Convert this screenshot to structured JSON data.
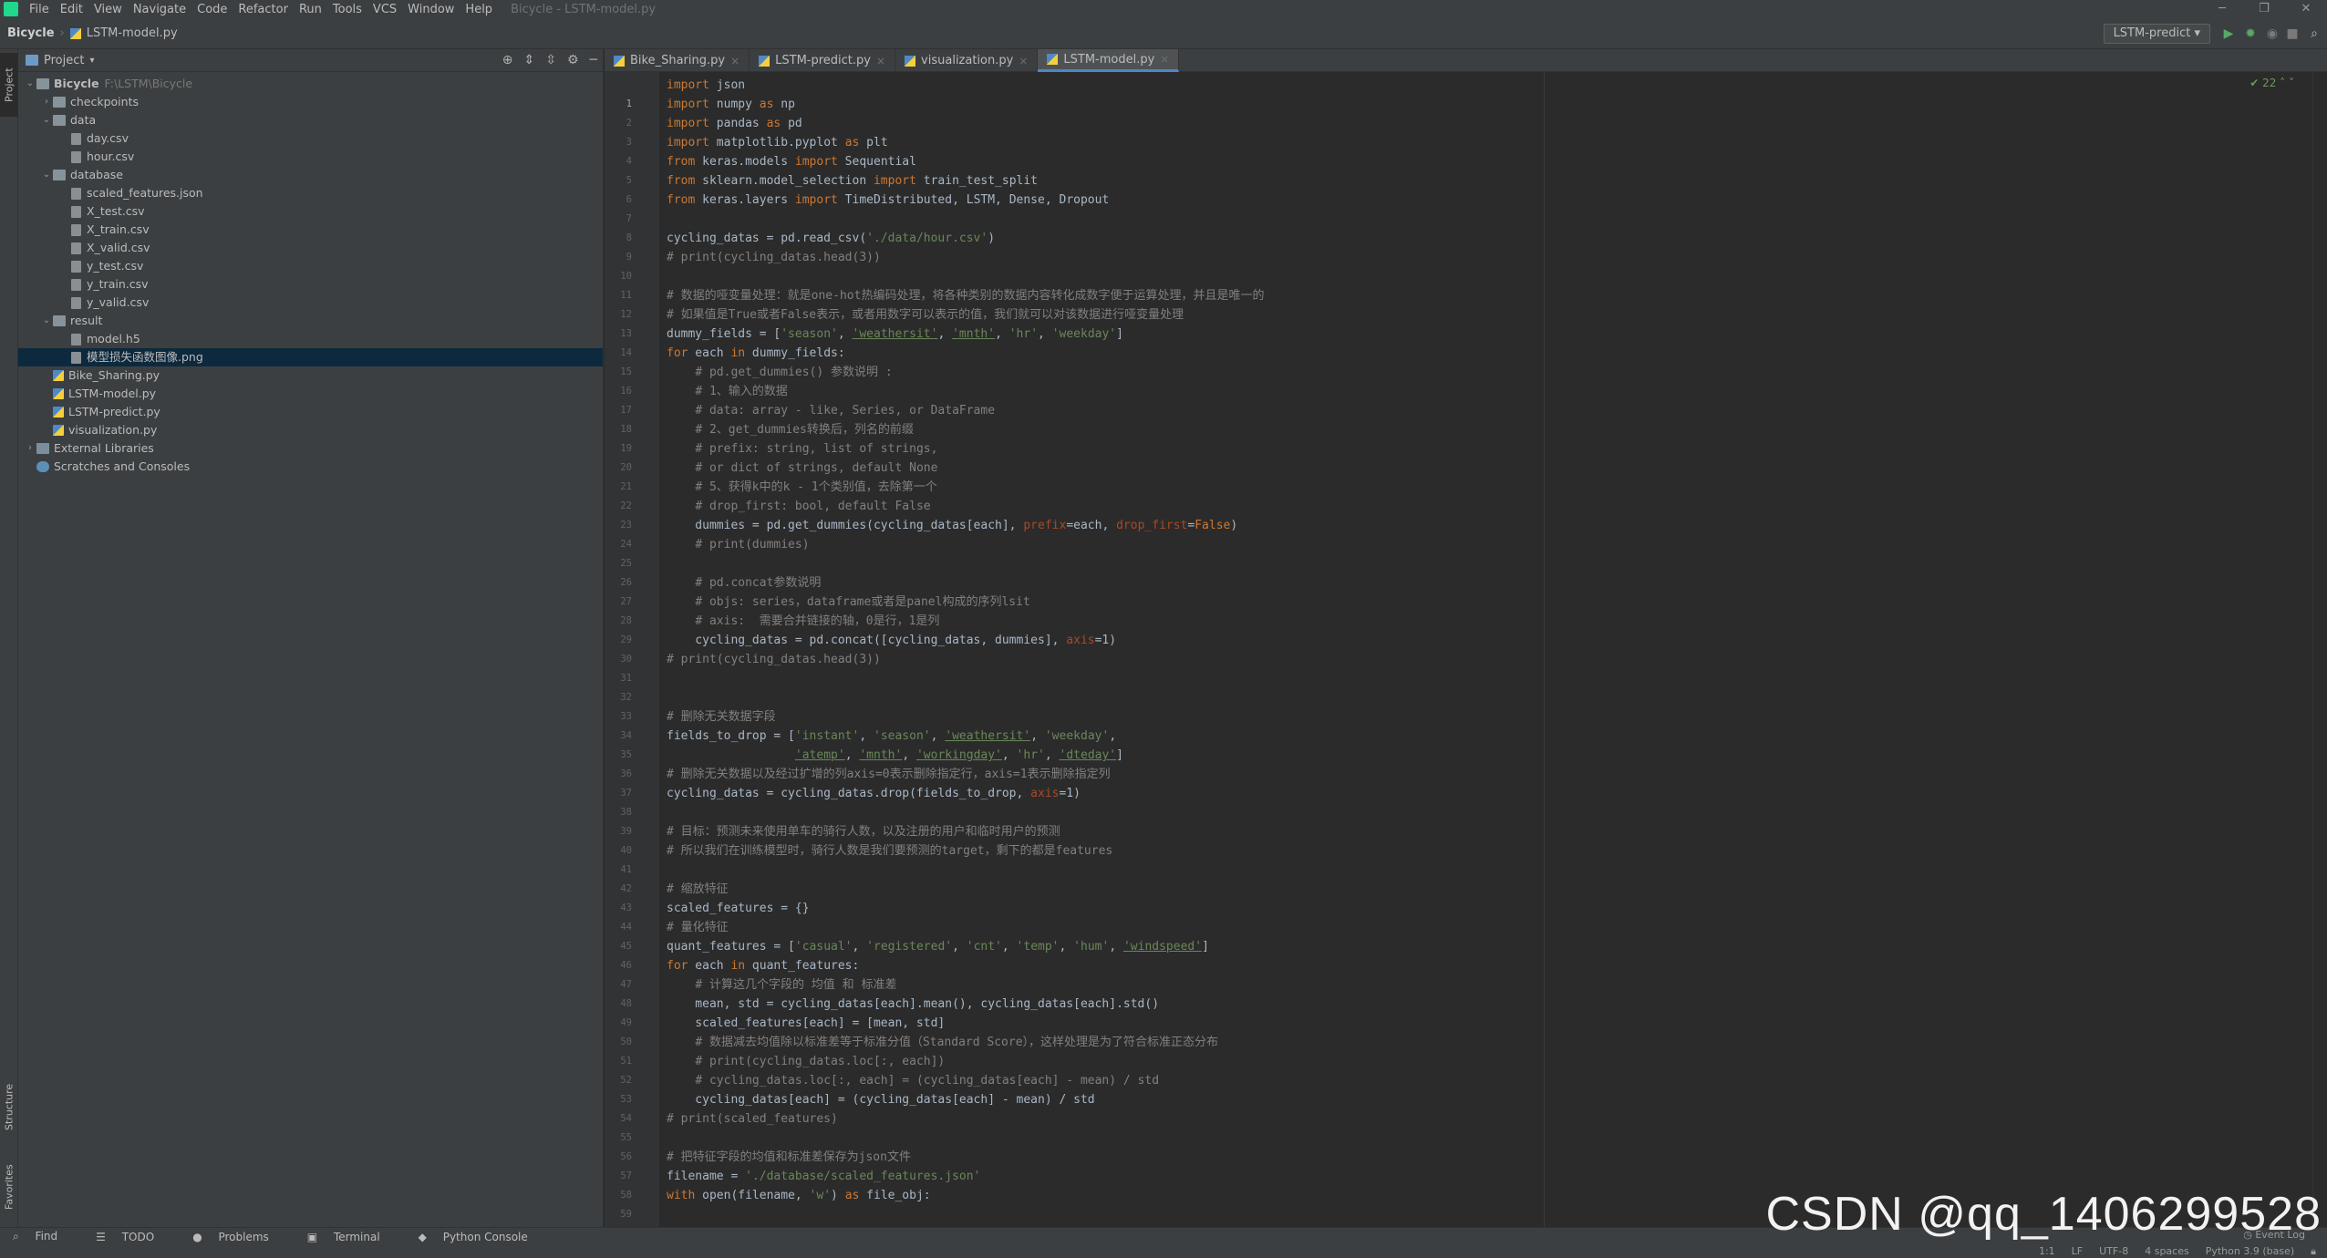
{
  "menubar": {
    "items": [
      "File",
      "Edit",
      "View",
      "Navigate",
      "Code",
      "Refactor",
      "Run",
      "Tools",
      "VCS",
      "Window",
      "Help"
    ],
    "window_title": "Bicycle - LSTM-model.py"
  },
  "navbar": {
    "project": "Bicycle",
    "file": "LSTM-model.py",
    "run_config": "LSTM-predict"
  },
  "sidebar": {
    "tabs": [
      "Project",
      "Structure",
      "Favorites"
    ],
    "header": "Project",
    "tree": [
      {
        "label": "Bicycle",
        "extra": "F:\\LSTM\\Bicycle",
        "depth": 0,
        "type": "folder",
        "open": true,
        "bold": true
      },
      {
        "label": "checkpoints",
        "depth": 1,
        "type": "folder",
        "open": false
      },
      {
        "label": "data",
        "depth": 1,
        "type": "folder",
        "open": true
      },
      {
        "label": "day.csv",
        "depth": 2,
        "type": "file"
      },
      {
        "label": "hour.csv",
        "depth": 2,
        "type": "file"
      },
      {
        "label": "database",
        "depth": 1,
        "type": "folder",
        "open": true
      },
      {
        "label": "scaled_features.json",
        "depth": 2,
        "type": "file"
      },
      {
        "label": "X_test.csv",
        "depth": 2,
        "type": "file"
      },
      {
        "label": "X_train.csv",
        "depth": 2,
        "type": "file"
      },
      {
        "label": "X_valid.csv",
        "depth": 2,
        "type": "file"
      },
      {
        "label": "y_test.csv",
        "depth": 2,
        "type": "file"
      },
      {
        "label": "y_train.csv",
        "depth": 2,
        "type": "file"
      },
      {
        "label": "y_valid.csv",
        "depth": 2,
        "type": "file"
      },
      {
        "label": "result",
        "depth": 1,
        "type": "folder",
        "open": true
      },
      {
        "label": "model.h5",
        "depth": 2,
        "type": "file"
      },
      {
        "label": "模型损失函数图像.png",
        "depth": 2,
        "type": "file",
        "selected": true
      },
      {
        "label": "Bike_Sharing.py",
        "depth": 1,
        "type": "py"
      },
      {
        "label": "LSTM-model.py",
        "depth": 1,
        "type": "py"
      },
      {
        "label": "LSTM-predict.py",
        "depth": 1,
        "type": "py"
      },
      {
        "label": "visualization.py",
        "depth": 1,
        "type": "py"
      },
      {
        "label": "External Libraries",
        "depth": 0,
        "type": "lib",
        "open": false
      },
      {
        "label": "Scratches and Consoles",
        "depth": 0,
        "type": "scr"
      }
    ]
  },
  "editor": {
    "tabs": [
      {
        "label": "Bike_Sharing.py",
        "active": false
      },
      {
        "label": "LSTM-predict.py",
        "active": false
      },
      {
        "label": "visualization.py",
        "active": false
      },
      {
        "label": "LSTM-model.py",
        "active": true
      }
    ],
    "inspection_count": "22",
    "code": [
      "import json",
      "import numpy as np",
      "import pandas as pd",
      "import matplotlib.pyplot as plt",
      "from keras.models import Sequential",
      "from sklearn.model_selection import train_test_split",
      "from keras.layers import TimeDistributed, LSTM, Dense, Dropout",
      "",
      "cycling_datas = pd.read_csv('./data/hour.csv')",
      "# print(cycling_datas.head(3))",
      "",
      "# 数据的哑变量处理：就是one-hot热编码处理，将各种类别的数据内容转化成数字便于运算处理，并且是唯一的",
      "# 如果值是True或者False表示，或者用数字可以表示的值，我们就可以对该数据进行哑变量处理",
      "dummy_fields = ['season', 'weathersit', 'mnth', 'hr', 'weekday']",
      "for each in dummy_fields:",
      "    # pd.get_dummies() 参数说明 :",
      "    # 1、输入的数据",
      "    # data: array - like, Series, or DataFrame",
      "    # 2、get_dummies转换后，列名的前缀",
      "    # prefix: string, list of strings,",
      "    # or dict of strings, default None",
      "    # 5、获得k中的k - 1个类别值，去除第一个",
      "    # drop_first: bool, default False",
      "    dummies = pd.get_dummies(cycling_datas[each], prefix=each, drop_first=False)",
      "    # print(dummies)",
      "",
      "    # pd.concat参数说明",
      "    # objs: series，dataframe或者是panel构成的序列lsit",
      "    # axis:  需要合并链接的轴，0是行，1是列",
      "    cycling_datas = pd.concat([cycling_datas, dummies], axis=1)",
      "# print(cycling_datas.head(3))",
      "",
      "",
      "# 删除无关数据字段",
      "fields_to_drop = ['instant', 'season', 'weathersit', 'weekday',",
      "                  'atemp', 'mnth', 'workingday', 'hr', 'dteday']",
      "# 删除无关数据以及经过扩增的列axis=0表示删除指定行，axis=1表示删除指定列",
      "cycling_datas = cycling_datas.drop(fields_to_drop, axis=1)",
      "",
      "# 目标：预测未来使用单车的骑行人数，以及注册的用户和临时用户的预测",
      "# 所以我们在训练模型时，骑行人数是我们要预测的target，剩下的都是features",
      "",
      "# 缩放特征",
      "scaled_features = {}",
      "# 量化特征",
      "quant_features = ['casual', 'registered', 'cnt', 'temp', 'hum', 'windspeed']",
      "for each in quant_features:",
      "    # 计算这几个字段的 均值 和 标准差",
      "    mean, std = cycling_datas[each].mean(), cycling_datas[each].std()",
      "    scaled_features[each] = [mean, std]",
      "    # 数据减去均值除以标准差等于标准分值（Standard Score），这样处理是为了符合标准正态分布",
      "    # print(cycling_datas.loc[:, each])",
      "    # cycling_datas.loc[:, each] = (cycling_datas[each] - mean) / std",
      "    cycling_datas[each] = (cycling_datas[each] - mean) / std",
      "# print(scaled_features)",
      "",
      "# 把特征字段的均值和标准差保存为json文件",
      "filename = './database/scaled_features.json'",
      "with open(filename, 'w') as file_obj:"
    ]
  },
  "bottom_tools": [
    "Find",
    "TODO",
    "Problems",
    "Terminal",
    "Python Console"
  ],
  "event_log": "Event Log",
  "status": {
    "position": "1:1",
    "line_sep": "LF",
    "encoding": "UTF-8",
    "indent": "4 spaces",
    "interpreter": "Python 3.9 (base)"
  },
  "watermark": "CSDN @qq_1406299528"
}
